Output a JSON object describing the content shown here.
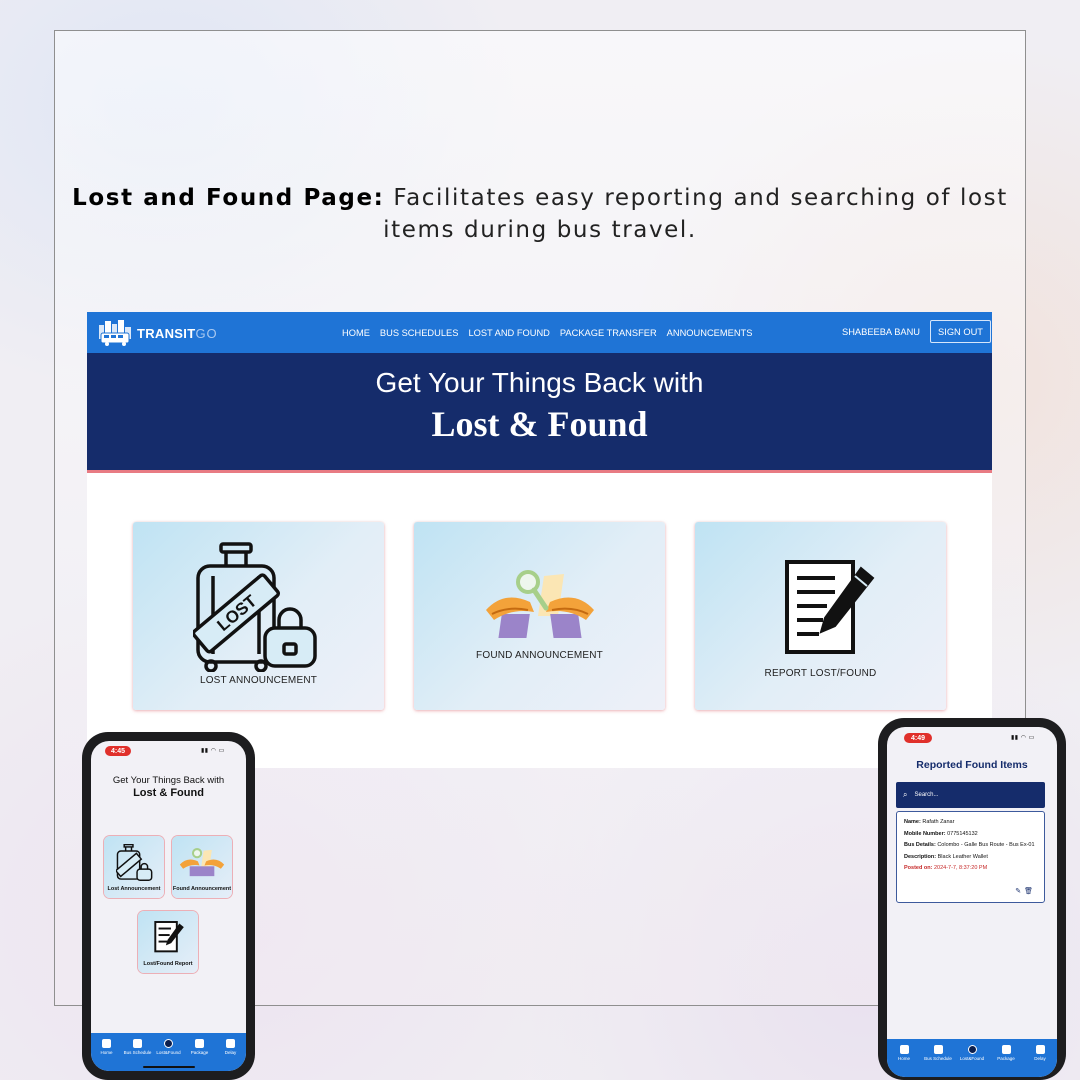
{
  "caption": {
    "bold": "Lost and Found Page:",
    "text": " Facilitates easy reporting and searching of lost items during bus travel."
  },
  "desktop": {
    "logo": {
      "brand": "TRANSIT",
      "suffix": "GO"
    },
    "nav": [
      "HOME",
      "BUS SCHEDULES",
      "LOST AND FOUND",
      "PACKAGE TRANSFER",
      "ANNOUNCEMENTS"
    ],
    "user": "SHABEEBA BANU",
    "signout": "SIGN OUT",
    "hero": {
      "subtitle": "Get Your Things Back with",
      "title": "Lost & Found"
    },
    "cards": [
      {
        "label": "LOST ANNOUNCEMENT",
        "icon": "luggage-lost-icon"
      },
      {
        "label": "FOUND ANNOUNCEMENT",
        "icon": "hands-magnifier-icon"
      },
      {
        "label": "REPORT LOST/FOUND",
        "icon": "document-pen-icon"
      }
    ],
    "colors": {
      "nav": "#1f74d6",
      "hero": "#152c6b",
      "accent": "#e87b83"
    }
  },
  "phone_left": {
    "time": "4:45",
    "subtitle": "Get Your Things Back with",
    "title": "Lost & Found",
    "cards": [
      {
        "label": "Lost Announcement"
      },
      {
        "label": "Found Announcement"
      },
      {
        "label": "Lost/Found Report"
      }
    ],
    "tabs": [
      "Home",
      "Bus Schedule",
      "Lost&Found",
      "Package",
      "Delay"
    ]
  },
  "phone_right": {
    "time": "4:49",
    "title": "Reported Found Items",
    "search_placeholder": "Search...",
    "item": {
      "name_label": "Name:",
      "name": "Rafath Zanar",
      "mobile_label": "Mobile Number:",
      "mobile": "0775145132",
      "bus_label": "Bus Details:",
      "bus": "Colombo - Galle Bus Route - Bus Ex-01",
      "desc_label": "Description:",
      "desc": "Black Leather Wallet",
      "posted_label": "Posted on:",
      "posted": "2024-7-7, 8:37:20 PM"
    },
    "tabs": [
      "Home",
      "Bus Schedule",
      "Lost&Found",
      "Package",
      "Delay"
    ]
  }
}
